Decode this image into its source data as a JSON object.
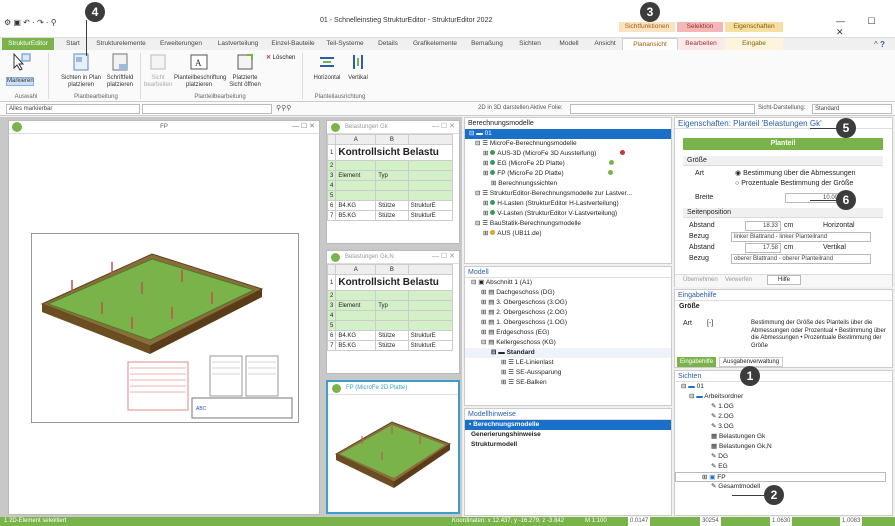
{
  "title": "01 - Schnelleinstieg StrukturEditor - StrukturEditor 2022",
  "qat": "⚙ ▣ ↶ · ↷ · ⚲",
  "window_controls": "— ☐ ✕",
  "context_groups": {
    "sichtfunktionen": "Sichtfunktionen",
    "selektion": "Selektion",
    "eigenschaften": "Eigenschaften"
  },
  "tabs": [
    "StrukturEditor",
    "Start",
    "Strukturelemente",
    "Erweiterungen",
    "Lastverteilung",
    "Einzel-Bauteile",
    "Teil-Systeme",
    "Details",
    "Grafikelemente",
    "Bemaßung",
    "Sichten",
    "Modell",
    "Ansicht",
    "Planansicht",
    "Bearbeiten",
    "Eingabe"
  ],
  "ribbon": {
    "markieren": "Markieren",
    "auswahl": "Auswahl",
    "sichten_plan": "Sichten in Plan platzieren",
    "schriftfeld": "Schriftfeld platzieren",
    "planbearbeitung": "Planbearbeitung",
    "sicht_bearbeiten": "Sicht bearbeiten",
    "planteilbeschriftung": "Planteilbeschriftung platzieren",
    "platzierte_sicht": "Platzierte Sicht öffnen",
    "loeschen": "Löschen",
    "planteilbearbeitung": "Planteilbearbeitung",
    "horizontal": "Horizontal",
    "vertikal": "Vertikal",
    "planteilausrichtung": "Planteilausrichtung"
  },
  "toolbar": {
    "filter": "Alles markierbar",
    "darstellen": "2D in 3D darstellen",
    "folie": "Aktive Folie:",
    "sichtdarstellung": "Sicht-Darstellung:",
    "standard": "Standard"
  },
  "fp_window": {
    "title": "FP",
    "controls": "— ☐ ✕"
  },
  "sheet1": {
    "title": "Belastungen Gk",
    "header_a": "A",
    "header_b": "B",
    "big": "Kontrollsicht Belastu",
    "element": "Element",
    "typ": "Typ",
    "r1": [
      "B4.KG",
      "Stütze",
      "StrukturE"
    ],
    "r2": [
      "B5.KG",
      "Stütze",
      "StrukturE"
    ],
    "rows": [
      "1",
      "2",
      "3",
      "4",
      "5",
      "6",
      "7",
      "8"
    ]
  },
  "sheet2": {
    "title": "Belastungen Gk,N",
    "header_a": "A",
    "header_b": "B",
    "big": "Kontrollsicht Belastu",
    "element": "Element",
    "typ": "Typ",
    "r1": [
      "B4.KG",
      "Stütze",
      "StrukturE"
    ],
    "r2": [
      "B5.KG",
      "Stütze",
      "StrukturE"
    ]
  },
  "sheet3": {
    "title": "FP (MicroFe 2D Platte)"
  },
  "berechnung": {
    "title": "Berechnungsmodelle",
    "items": [
      "01",
      "MicroFe-Berechnungsmodelle",
      "AUS-3D (MicroFe 3D Aussteifung)",
      "EG (MicroFe 2D Platte)",
      "FP (MicroFe 2D Platte)",
      "Berechnungssichten",
      "StrukturEditor-Berechnungsmodelle zur Lastver...",
      "H-Lasten (StrukturEditor H-Lastverteilung)",
      "V-Lasten (StrukturEditor V-Lastverteilung)",
      "BauStatik-Berechnungsmodelle",
      "AUS (UB11.de)"
    ]
  },
  "modell": {
    "title": "Modell",
    "items": [
      "Abschnitt 1 (A1)",
      "Dachgeschoss (DG)",
      "3. Obergeschoss (3.OG)",
      "2. Obergeschoss (2.OG)",
      "1. Obergeschoss (1.OG)",
      "Erdgeschoss (EG)",
      "Kellergeschoss (KG)",
      "Standard",
      "LE-Linienlast",
      "SE-Aussparung",
      "SE-Balken"
    ]
  },
  "hinweise": {
    "title": "Modellhinweise",
    "items": [
      "Berechnungsmodelle",
      "Generierungshinweise",
      "Strukturmodell"
    ]
  },
  "eigenschaften": {
    "title": "Eigenschaften: Planteil 'Belastungen Gk'",
    "planteil": "Planteil",
    "groesse": "Größe",
    "art": "Art",
    "opt1": "Bestimmung über die Abmessungen",
    "opt2": "Prozentuale Bestimmung der Größe",
    "breite": "Breite",
    "breite_val": "10.00",
    "unit_cm": "cm",
    "seitenposition": "Seitenposition",
    "abstand": "Abstand",
    "abstand1": "18.33",
    "horizontal": "Horizontal",
    "bezug": "Bezug",
    "bezug1": "linker Blattrand - linker Planteilrand",
    "abstand2": "17.58",
    "vertikal": "Vertikal",
    "bezug2": "oberer Blattrand - oberer Planteilrand",
    "uebernehmen": "Übernehmen",
    "verwerfen": "Verwerfen",
    "hilfe": "Hilfe"
  },
  "eingabehilfe": {
    "title": "Eingabehilfe",
    "groesse": "Größe",
    "art": "Art",
    "bracket": "[-]",
    "text": "Bestimmung der Größe des Planteils über die Abmessungen oder Prozentual • Bestimmung über die Abmessungen • Prozentuale Bestimmung der Größe",
    "tab1": "Eingabehilfe",
    "tab2": "Ausgabenverwaltung"
  },
  "sichten": {
    "title": "Sichten",
    "items": [
      "01",
      "Arbeitsordner",
      "1.OG",
      "2.OG",
      "3.OG",
      "Belastungen Gk",
      "Belastungen Gk,N",
      "DG",
      "EG",
      "FP",
      "Gesamtmodell"
    ]
  },
  "status": {
    "left": "1 2D-Element selektiert",
    "coords": "Koordinaten: x 12.437, y -16.279, z -3.842",
    "scale": "M 1:100",
    "v1": "0.0147",
    "v2": "30254",
    "v3": "1.0630",
    "v4": "1.0083"
  },
  "badges": [
    "1",
    "2",
    "3",
    "4",
    "5",
    "6"
  ],
  "colors": {
    "accent": "#7ab34a",
    "blue": "#2a5ea8",
    "orange": "#f0a030",
    "pink": "#f4b6b6",
    "yellow": "#f6dfa0"
  }
}
